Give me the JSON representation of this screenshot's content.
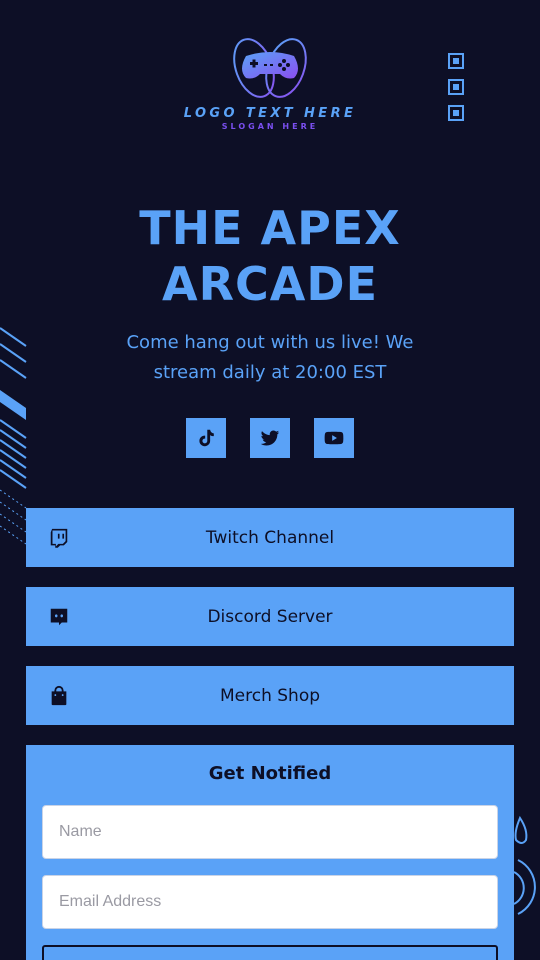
{
  "logo": {
    "text": "LOGO TEXT HERE",
    "slogan": "SLOGAN HERE",
    "icon": "gamepad-icon"
  },
  "hero": {
    "title_line1": "THE APEX",
    "title_line2": "ARCADE",
    "subtitle": "Come hang out with us live! We stream daily at 20:00 EST"
  },
  "socials": [
    {
      "icon": "tiktok-icon"
    },
    {
      "icon": "twitter-icon"
    },
    {
      "icon": "youtube-icon"
    }
  ],
  "links": [
    {
      "label": "Twitch Channel",
      "icon": "twitch-icon"
    },
    {
      "label": "Discord Server",
      "icon": "discord-icon"
    },
    {
      "label": "Merch Shop",
      "icon": "shopping-bag-icon"
    }
  ],
  "form": {
    "title": "Get Notified",
    "name_placeholder": "Name",
    "email_placeholder": "Email Address"
  },
  "colors": {
    "background": "#0d0f26",
    "accent": "#5aa2f7",
    "accent_purple": "#7a4ff0"
  }
}
